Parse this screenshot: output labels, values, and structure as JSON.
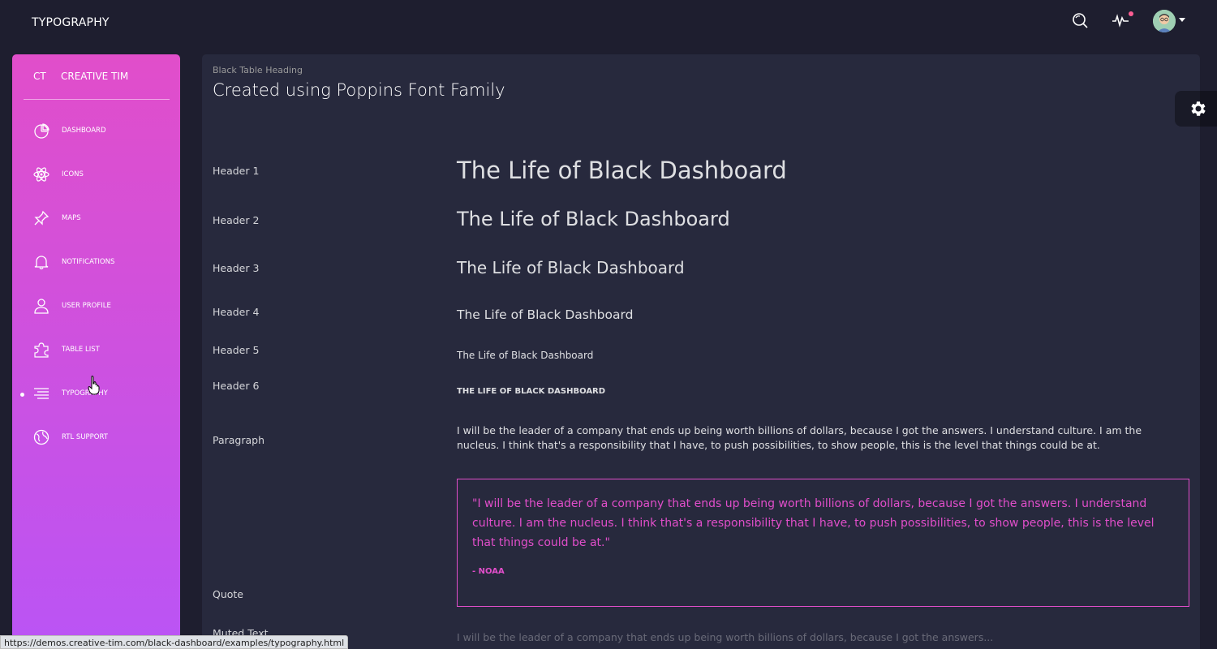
{
  "topbar": {
    "title": "TYPOGRAPHY",
    "icons": [
      "search-icon",
      "pulse-icon",
      "avatar",
      "caret-down-icon"
    ],
    "notification_color": "#fd5d93"
  },
  "sidebar": {
    "logo_mini": "CT",
    "logo_text": "CREATIVE TIM",
    "gradient": [
      "#e14eca",
      "#ba54f5"
    ],
    "items": [
      {
        "label": "DASHBOARD",
        "icon": "chart-pie-icon"
      },
      {
        "label": "ICONS",
        "icon": "atom-icon"
      },
      {
        "label": "MAPS",
        "icon": "pin-icon"
      },
      {
        "label": "NOTIFICATIONS",
        "icon": "bell-icon"
      },
      {
        "label": "USER PROFILE",
        "icon": "user-icon"
      },
      {
        "label": "TABLE LIST",
        "icon": "puzzle-icon"
      },
      {
        "label": "TYPOGRAPHY",
        "icon": "align-center-icon",
        "active": true
      },
      {
        "label": "RTL SUPPORT",
        "icon": "world-icon"
      }
    ]
  },
  "card": {
    "category": "Black Table Heading",
    "title": "Created using Poppins Font Family",
    "rows": {
      "h1": {
        "label": "Header 1",
        "text": "The Life of Black Dashboard"
      },
      "h2": {
        "label": "Header 2",
        "text": "The Life of Black Dashboard"
      },
      "h3": {
        "label": "Header 3",
        "text": "The Life of Black Dashboard"
      },
      "h4": {
        "label": "Header 4",
        "text": "The Life of Black Dashboard"
      },
      "h5": {
        "label": "Header 5",
        "text": "The Life of Black Dashboard"
      },
      "h6": {
        "label": "Header 6",
        "text": "THE LIFE OF BLACK DASHBOARD"
      },
      "paragraph": {
        "label": "Paragraph",
        "text": "I will be the leader of a company that ends up being worth billions of dollars, because I got the answers. I understand culture. I am the nucleus. I think that's a responsibility that I have, to push possibilities, to show people, this is the level that things could be at."
      },
      "quote": {
        "label": "Quote",
        "text": "\"I will be the leader of a company that ends up being worth billions of dollars, because I got the answers. I understand culture. I am the nucleus. I think that's a responsibility that I have, to push possibilities, to show people, this is the level that things could be at.\"",
        "author": "- NOAA"
      },
      "muted": {
        "label": "Muted Text",
        "text": "I will be the leader of a company that ends up being worth billions of dollars, because I got the answers..."
      }
    },
    "accent": "#e14eca"
  },
  "settings": {
    "icon": "gear-icon"
  },
  "statusbar": {
    "url": "https://demos.creative-tim.com/black-dashboard/examples/typography.html"
  }
}
